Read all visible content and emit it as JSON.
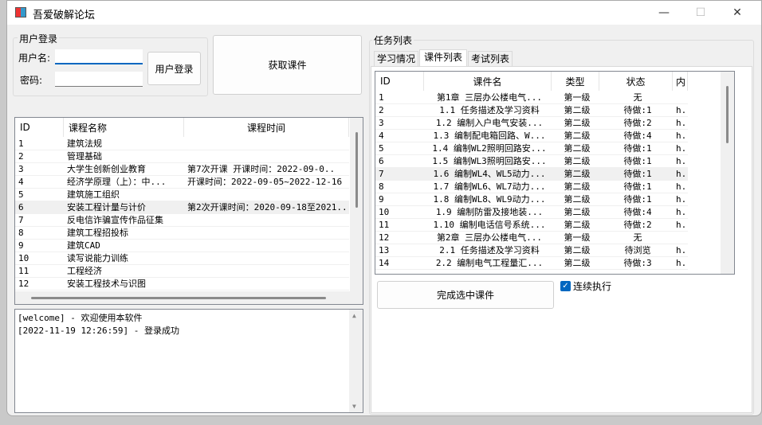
{
  "window": {
    "title": "吾爱破解论坛",
    "minimize": "—",
    "maximize": "☐",
    "close": "✕"
  },
  "login": {
    "group_title": "用户登录",
    "username_label": "用户名:",
    "username_value": "",
    "password_label": "密码:",
    "password_value": "",
    "login_button": "用户登录"
  },
  "fetch_button": "获取课件",
  "courses": {
    "headers": [
      "ID",
      "课程名称",
      "课程时间"
    ],
    "rows": [
      [
        "1",
        "建筑法规",
        ""
      ],
      [
        "2",
        "管理基础",
        ""
      ],
      [
        "3",
        "大学生创新创业教育",
        "第7次开课    开课时间：2022-09-0.."
      ],
      [
        "4",
        "经济学原理（上）：中...",
        "  开课时间：2022-09-05~2022-12-16"
      ],
      [
        "5",
        "建筑施工组织",
        ""
      ],
      [
        "6",
        "安装工程计量与计价",
        "第2次开课时间：2020-09-18至2021.."
      ],
      [
        "7",
        "反电信诈骗宣传作品征集",
        ""
      ],
      [
        "8",
        "建筑工程招投标",
        ""
      ],
      [
        "9",
        "建筑CAD",
        ""
      ],
      [
        "10",
        "读写说能力训练",
        ""
      ],
      [
        "11",
        "工程经济",
        ""
      ],
      [
        "12",
        "安装工程技术与识图",
        ""
      ]
    ],
    "selected_index": 5
  },
  "log": {
    "lines": [
      "[welcome] - 欢迎使用本软件",
      "[2022-11-19 12:26:59] - 登录成功"
    ]
  },
  "tasks": {
    "group_title": "任务列表",
    "tabs": [
      "学习情况",
      "课件列表",
      "考试列表"
    ],
    "active_tab": 1,
    "headers": [
      "ID",
      "课件名",
      "类型",
      "状态",
      "内"
    ],
    "rows": [
      [
        "1",
        "第1章 三层办公楼电气...",
        "第一级",
        "无",
        ""
      ],
      [
        "2",
        " 1.1 任务描述及学习资料",
        "第二级",
        "待做:1",
        "h."
      ],
      [
        "3",
        "1.2 编制入户电气安装...",
        "第二级",
        "待做:2",
        "h."
      ],
      [
        "4",
        "1.3 编制配电箱回路、W...",
        "第二级",
        "待做:4",
        "h."
      ],
      [
        "5",
        "1.4 编制WL2照明回路安...",
        "第二级",
        "待做:1",
        "h."
      ],
      [
        "6",
        "1.5 编制WL3照明回路安...",
        "第二级",
        "待做:1",
        "h."
      ],
      [
        "7",
        "1.6 编制WL4、WL5动力...",
        "第二级",
        "待做:1",
        "h."
      ],
      [
        "8",
        "1.7 编制WL6、WL7动力...",
        "第二级",
        "待做:1",
        "h."
      ],
      [
        "9",
        "1.8 编制WL8、WL9动力...",
        "第二级",
        "待做:1",
        "h."
      ],
      [
        "10",
        "1.9 编制防雷及接地装...",
        "第二级",
        "待做:4",
        "h."
      ],
      [
        "11",
        "1.10 编制电话信号系统...",
        "第二级",
        "待做:2",
        "h."
      ],
      [
        "12",
        "第2章 三层办公楼电气...",
        "第一级",
        "无",
        ""
      ],
      [
        "13",
        " 2.1 任务描述及学习资料",
        "第二级",
        "待浏览",
        "h."
      ],
      [
        "14",
        "2.2 编制电气工程量汇...",
        "第二级",
        "待做:3",
        "h."
      ]
    ],
    "selected_index": 6
  },
  "complete_button": "完成选中课件",
  "continuous": {
    "label": "连续执行",
    "checked": true
  },
  "colors": {
    "accent": "#0067c0",
    "selection": "#f0f0f0"
  }
}
